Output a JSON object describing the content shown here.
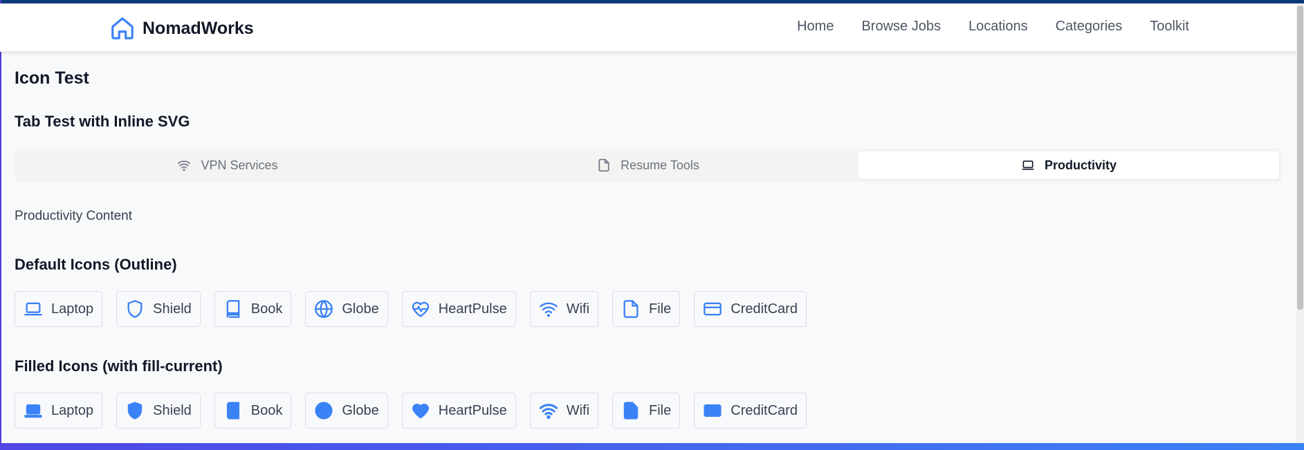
{
  "brand": {
    "name": "NomadWorks",
    "icon": "home-icon"
  },
  "nav": [
    "Home",
    "Browse Jobs",
    "Locations",
    "Categories",
    "Toolkit"
  ],
  "page_title": "Icon Test",
  "tab_section": {
    "title": "Tab Test with Inline SVG",
    "tabs": [
      {
        "label": "VPN Services",
        "icon": "wifi-icon",
        "active": false
      },
      {
        "label": "Resume Tools",
        "icon": "file-icon",
        "active": false
      },
      {
        "label": "Productivity",
        "icon": "laptop-icon",
        "active": true
      }
    ],
    "content": "Productivity Content"
  },
  "outline_section": {
    "title": "Default Icons (Outline)",
    "icons": [
      "Laptop",
      "Shield",
      "Book",
      "Globe",
      "HeartPulse",
      "Wifi",
      "File",
      "CreditCard"
    ]
  },
  "filled_section": {
    "title": "Filled Icons (with fill-current)",
    "icons": [
      "Laptop",
      "Shield",
      "Book",
      "Globe",
      "HeartPulse",
      "Wifi",
      "File",
      "CreditCard"
    ]
  },
  "colors": {
    "accent": "#3b82f6",
    "bottom_gradient_start": "#4f46e5",
    "top_strip": "#0b3a7a"
  }
}
